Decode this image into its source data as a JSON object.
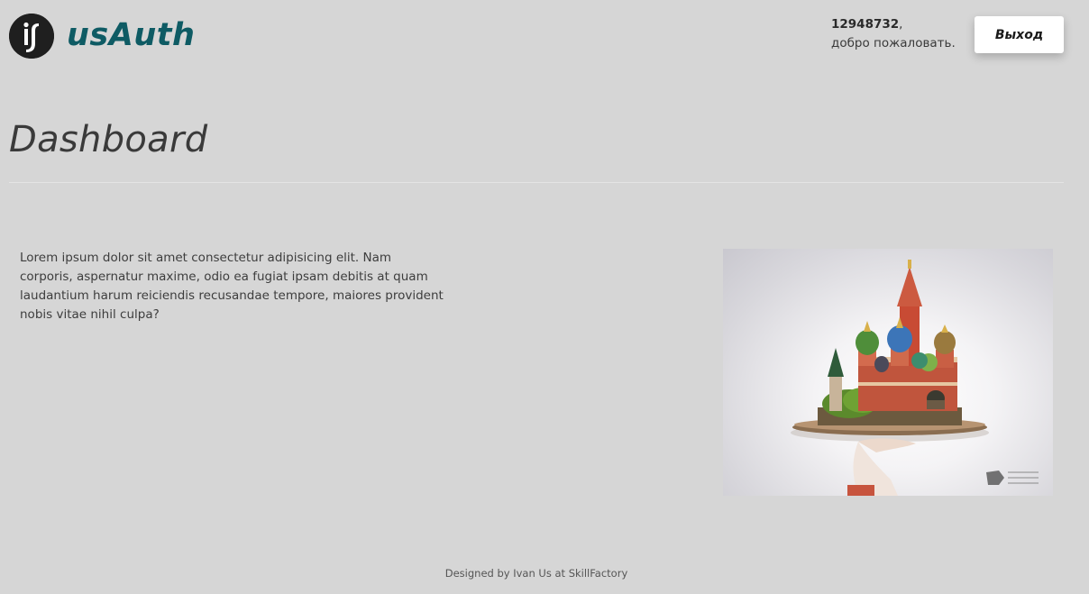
{
  "header": {
    "brand": "usAuth",
    "user_id": "12948732",
    "greeting_suffix": "доб­ро пожаловать.",
    "logout_label": "Выход"
  },
  "main": {
    "title": "Dashboard",
    "text": "Lorem ipsum dolor sit amet consectetur adipisicing elit. Nam corporis, aspernatur maxime, odio ea fugiat ipsam debitis at quam laudantium harum reiciendis recusandae tempore, maiores provident nobis vitae nihil culpa?",
    "image_icon": "kremlin-on-tray-image"
  },
  "footer": {
    "credit": "Designed by Ivan Us at SkillFactory"
  },
  "colors": {
    "background": "#d6d6d6",
    "brand": "#0e5b64",
    "button_bg": "#ffffff",
    "text": "#3d3d3d"
  }
}
